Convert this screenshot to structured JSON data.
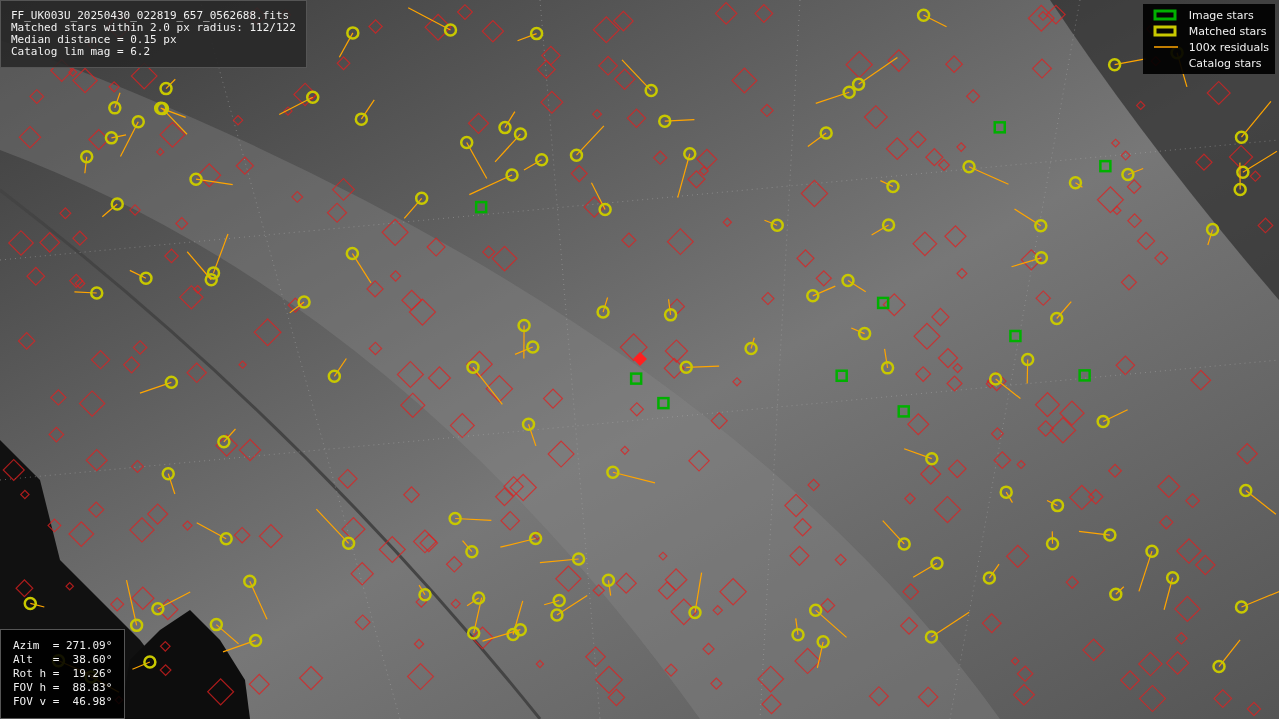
{
  "info_box": {
    "lines": [
      "FF_UK003U_20250430_022819_657_0562688.fits",
      "Matched stars within 2.0 px radius: 112/122",
      "Median distance = 0.15 px",
      "Catalog lim mag = 6.2"
    ]
  },
  "legend": {
    "items": [
      {
        "label": "Image stars"
      },
      {
        "kind": "matched",
        "label": "Matched stars"
      },
      {
        "kind": "residual",
        "label": "100x residuals"
      },
      {
        "kind": "catalog",
        "label": "Catalog stars"
      }
    ]
  },
  "pointing_box": {
    "lines": [
      "Azim  = 271.09°",
      "Alt   =  38.60°",
      "Rot h =  19.26°",
      "FOV h =  88.83°",
      "FOV v =  46.98°"
    ]
  }
}
